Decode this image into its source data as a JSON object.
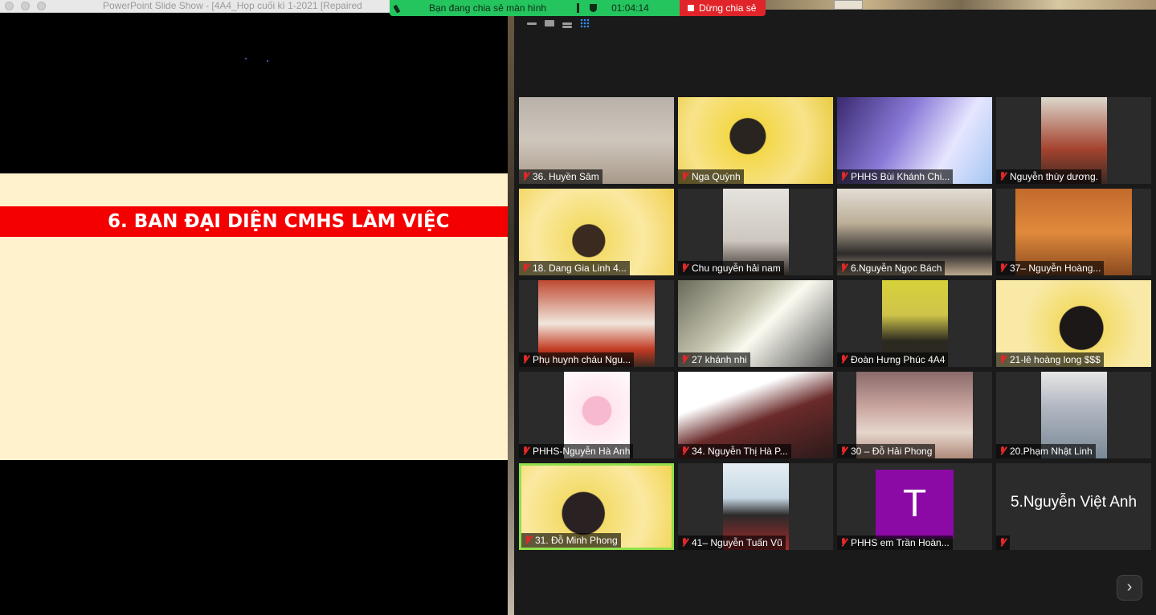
{
  "slideshow": {
    "window_title": "PowerPoint Slide Show - [4A4_Họp cuối kì 1-2021 [Repaired",
    "slide_heading": "6. BAN ĐẠI DIỆN CMHS LÀM VIỆC"
  },
  "share_bar": {
    "status_text": "Bạn đang chia sẻ màn hình",
    "timer": "01:04:14",
    "stop_label": "Dừng chia sẻ"
  },
  "gallery": {
    "participants": [
      {
        "name": "36. Huyền Sâm"
      },
      {
        "name": "Nga Quỳnh"
      },
      {
        "name": "PHHS Bùi Khánh  Chi..."
      },
      {
        "name": "Nguyễn thùy dương."
      },
      {
        "name": "18. Dang Gia Linh 4..."
      },
      {
        "name": "Chu nguyễn hải nam"
      },
      {
        "name": "6.Nguyễn Ngọc Bách"
      },
      {
        "name": "37– Nguyễn Hoàng..."
      },
      {
        "name": "Phụ huynh cháu Ngu..."
      },
      {
        "name": "27 khánh nhi"
      },
      {
        "name": "Đoàn Hưng Phúc 4A4"
      },
      {
        "name": "21-lê hoàng long $$$"
      },
      {
        "name": "PHHS-Nguyễn  Hà Anh"
      },
      {
        "name": "34. Nguyễn Thị Hà P..."
      },
      {
        "name": "30 – Đỗ Hải Phong"
      },
      {
        "name": "20.Phạm Nhật Linh"
      },
      {
        "name": "31. Đỗ Minh Phong"
      },
      {
        "name": "41– Nguyễn Tuấn Vũ"
      },
      {
        "name": "PHHS em Trần Hoàn...",
        "avatar_letter": "T"
      },
      {
        "name": "5.Nguyễn Việt Anh"
      }
    ],
    "next_page_icon": "chevron-right-icon"
  },
  "colors": {
    "slide_background": "#fff2cc",
    "slide_banner": "#f40000",
    "share_green": "#24c45e",
    "stop_red": "#e0242a",
    "active_speaker": "#8fe04a",
    "avatar_purple": "#8b0aa5"
  }
}
